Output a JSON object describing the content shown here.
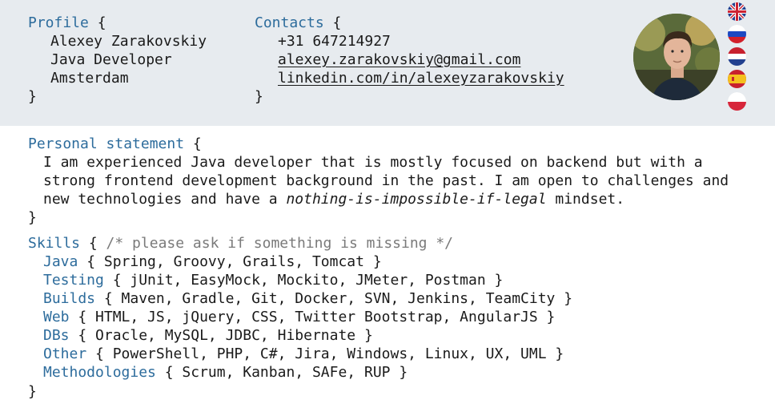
{
  "profile": {
    "heading": "Profile",
    "open": " {",
    "name": "Alexey Zarakovskiy",
    "title": "Java Developer",
    "city": "Amsterdam",
    "close": "}"
  },
  "contacts": {
    "heading": "Contacts",
    "open": " {",
    "phone": "+31 647214927",
    "email": "alexey.zarakovskiy@gmail.com",
    "linkedin": "linkedin.com/in/alexeyzarakovskiy",
    "close": "}"
  },
  "languages": [
    {
      "code": "en",
      "icon": "uk-flag-icon"
    },
    {
      "code": "ru",
      "icon": "russia-flag-icon"
    },
    {
      "code": "nl",
      "icon": "netherlands-flag-icon"
    },
    {
      "code": "es",
      "icon": "spain-flag-icon"
    },
    {
      "code": "pl",
      "icon": "poland-flag-icon"
    }
  ],
  "statement": {
    "heading": "Personal statement",
    "open": " {",
    "line1": "I am experienced Java developer that is mostly focused on backend but with a",
    "line2": "strong frontend development background in the past. I am open to challenges and",
    "line3_a": "new technologies and have a ",
    "line3_em": "nothing-is-impossible-if-legal",
    "line3_b": " mindset.",
    "close": "}"
  },
  "skills": {
    "heading": "Skills",
    "open": " { ",
    "comment": "/* please ask if something is missing */",
    "close": "}",
    "groups": [
      {
        "name": "Java",
        "items": " { Spring, Groovy, Grails, Tomcat }"
      },
      {
        "name": "Testing",
        "items": " { jUnit, EasyMock, Mockito, JMeter, Postman }"
      },
      {
        "name": "Builds",
        "items": " { Maven, Gradle, Git, Docker, SVN, Jenkins, TeamCity }"
      },
      {
        "name": "Web",
        "items": " { HTML, JS, jQuery, CSS, Twitter Bootstrap, AngularJS }"
      },
      {
        "name": "DBs",
        "items": " { Oracle, MySQL, JDBC, Hibernate }"
      },
      {
        "name": "Other",
        "items": " { PowerShell, PHP, C#, Jira, Windows, Linux, UX, UML }"
      },
      {
        "name": "Methodologies",
        "items": " { Scrum, Kanban, SAFe, RUP }"
      }
    ]
  },
  "colors": {
    "keyword": "#2d6c9c",
    "header_bg": "#e7ebef",
    "comment": "#7a7a7a"
  }
}
